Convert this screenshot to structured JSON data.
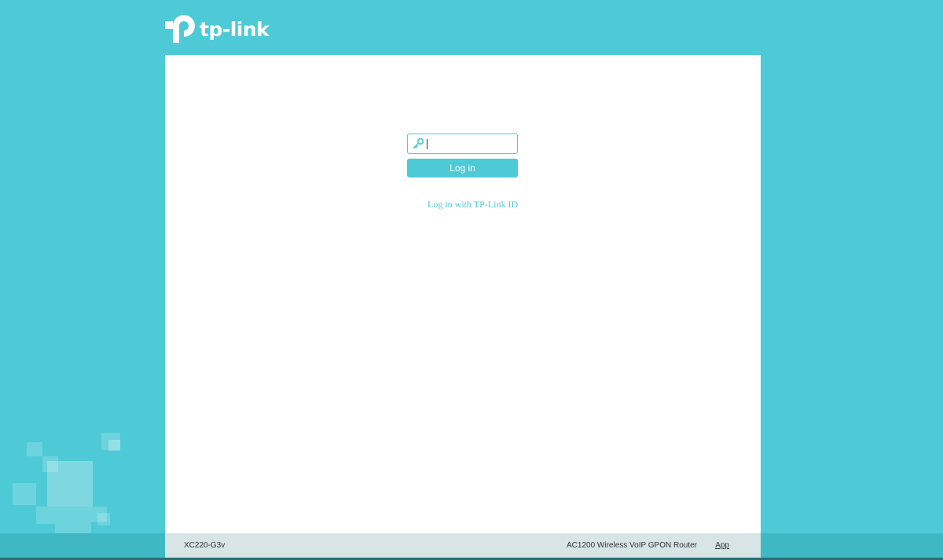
{
  "brand": {
    "logo_text": "tp-link",
    "logo_icon": "tp-link-logo-icon"
  },
  "login": {
    "password_icon": "key-icon",
    "password_value": "",
    "login_label": "Log in",
    "tplink_id_label": "Log in with TP-Link ID"
  },
  "footer": {
    "model": "XC220-G3v",
    "product": "AC1200 Wireless VoIP GPON Router",
    "app_label": "App"
  },
  "colors": {
    "accent": "#4ecad6",
    "footer_bg": "#d7e5e7",
    "panel_bg": "#ffffff"
  }
}
